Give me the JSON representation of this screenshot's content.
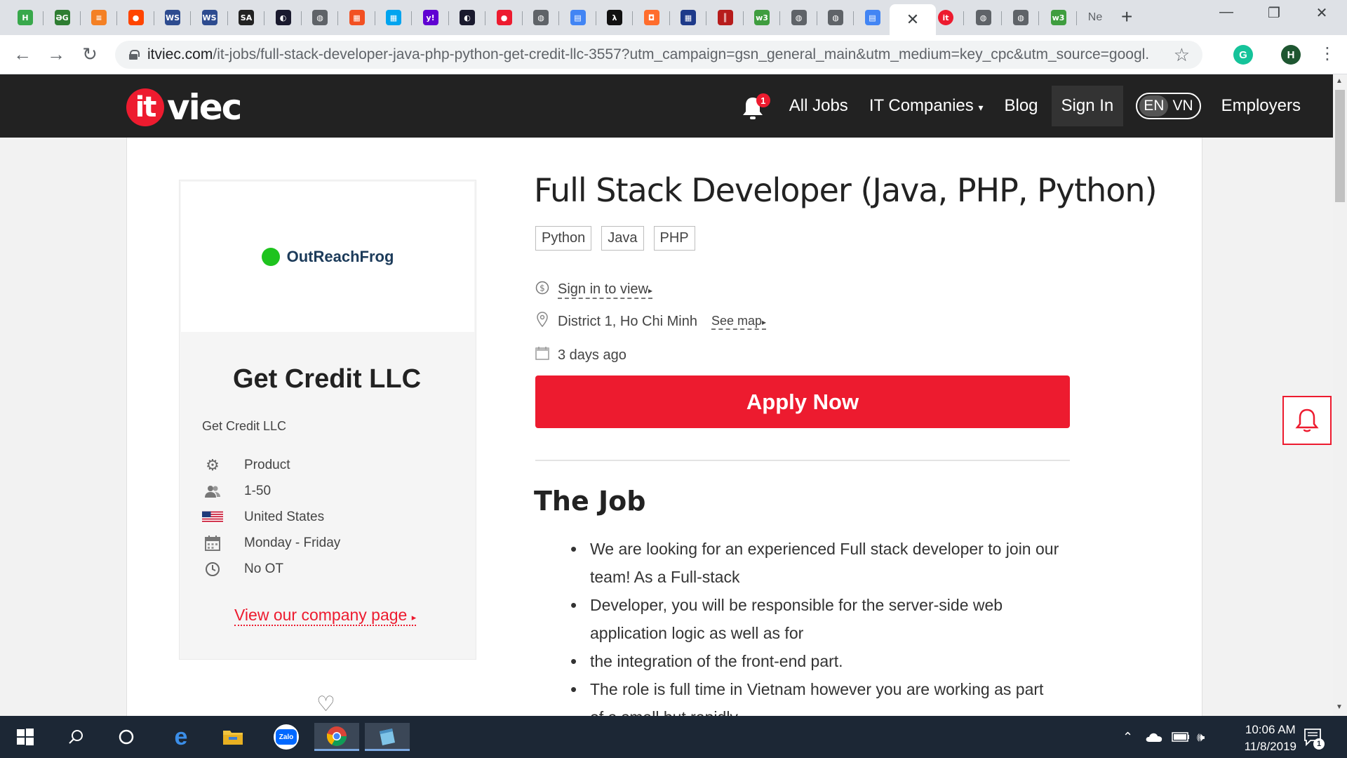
{
  "browser": {
    "tabs": [
      {
        "icon": "hubstaff-icon",
        "glyph": "H",
        "color": "#38a84b"
      },
      {
        "icon": "dict-icon",
        "glyph": "ƏG",
        "color": "#2e7d32"
      },
      {
        "icon": "stackoverflow-icon",
        "glyph": "≡",
        "color": "#f48024"
      },
      {
        "icon": "reddit-icon",
        "glyph": "●",
        "color": "#ff4500"
      },
      {
        "icon": "w3schools-icon",
        "glyph": "WS",
        "color": "#2d4b8f"
      },
      {
        "icon": "w3schools-icon",
        "glyph": "WS",
        "color": "#2d4b8f"
      },
      {
        "icon": "sa-icon",
        "glyph": "SA",
        "color": "#222222"
      },
      {
        "icon": "oval-logo-icon",
        "glyph": "◐",
        "color": "#1a1a2e"
      },
      {
        "icon": "globe-icon",
        "glyph": "◍",
        "color": "#5f6368"
      },
      {
        "icon": "microsoft-icon",
        "glyph": "▦",
        "color": "#f25022"
      },
      {
        "icon": "microsoft-icon",
        "glyph": "▦",
        "color": "#00a4ef"
      },
      {
        "icon": "yahoo-icon",
        "glyph": "y!",
        "color": "#6001d2"
      },
      {
        "icon": "oval-logo-icon",
        "glyph": "◐",
        "color": "#1a1a2e"
      },
      {
        "icon": "red-badge-icon",
        "glyph": "●",
        "color": "#ed1b2f"
      },
      {
        "icon": "globe-icon",
        "glyph": "◍",
        "color": "#5f6368"
      },
      {
        "icon": "google-docs-icon",
        "glyph": "▤",
        "color": "#4285f4"
      },
      {
        "icon": "lambda-icon",
        "glyph": "λ",
        "color": "#111111"
      },
      {
        "icon": "ring-icon",
        "glyph": "◘",
        "color": "#ff6d2d"
      },
      {
        "icon": "grid-icon",
        "glyph": "▦",
        "color": "#1e3a8a"
      },
      {
        "icon": "bars-icon",
        "glyph": "║",
        "color": "#b71c1c"
      },
      {
        "icon": "w3c-icon",
        "glyph": "w3",
        "color": "#3f9d3f"
      },
      {
        "icon": "globe-icon",
        "glyph": "◍",
        "color": "#5f6368"
      },
      {
        "icon": "globe-icon",
        "glyph": "◍",
        "color": "#5f6368"
      },
      {
        "icon": "google-docs-icon",
        "glyph": "▤",
        "color": "#4285f4"
      }
    ],
    "after_tabs": [
      {
        "icon": "itviec-icon",
        "glyph": "it",
        "color": "#ed1b2f"
      },
      {
        "icon": "globe-icon",
        "glyph": "◍",
        "color": "#5f6368"
      },
      {
        "icon": "globe-icon",
        "glyph": "◍",
        "color": "#5f6368"
      },
      {
        "icon": "w3c-icon",
        "glyph": "w3",
        "color": "#3f9d3f"
      }
    ],
    "last_tab_label": "Ne",
    "url_domain": "itviec.com",
    "url_path": "/it-jobs/full-stack-developer-java-php-python-get-credit-llc-3557?utm_campaign=gsn_general_main&utm_medium=key_cpc&utm_source=googl...",
    "profile_initial": "H",
    "grammarly_initial": "G"
  },
  "site": {
    "logo_it": "it",
    "logo_viec": "viec",
    "notification_count": "1",
    "nav": {
      "all_jobs": "All Jobs",
      "it_companies": "IT Companies",
      "blog": "Blog",
      "sign_in": "Sign In",
      "lang_en": "EN",
      "lang_vn": "VN",
      "employers": "Employers"
    }
  },
  "company": {
    "logo_text": "OutReachFrog",
    "name": "Get Credit LLC",
    "subtitle": "Get Credit LLC",
    "attributes": [
      {
        "icon": "gear-icon",
        "label": "Product"
      },
      {
        "icon": "people-icon",
        "label": "1-50"
      },
      {
        "icon": "us-flag-icon",
        "label": "United States"
      },
      {
        "icon": "calendar-icon",
        "label": "Monday - Friday"
      },
      {
        "icon": "clock-icon",
        "label": "No OT"
      }
    ],
    "link": "View our company page"
  },
  "job": {
    "title": "Full Stack Developer (Java, PHP, Python)",
    "tags": [
      "Python",
      "Java",
      "PHP"
    ],
    "salary": "Sign in to view",
    "location": "District 1, Ho Chi Minh",
    "see_map": "See map",
    "posted": "3 days ago",
    "apply": "Apply Now",
    "section_title": "The Job",
    "bullets": [
      "We are looking for an experienced Full stack developer to join our",
      "team! As a Full-stack",
      "Developer, you will be responsible for the server-side web",
      "application logic as well as for",
      "the integration of the front-end part.",
      "The role is full time in Vietnam however you are working as part",
      "of a small but rapidly"
    ]
  },
  "taskbar": {
    "time": "10:06 AM",
    "date": "11/8/2019",
    "notif_count": "1"
  }
}
